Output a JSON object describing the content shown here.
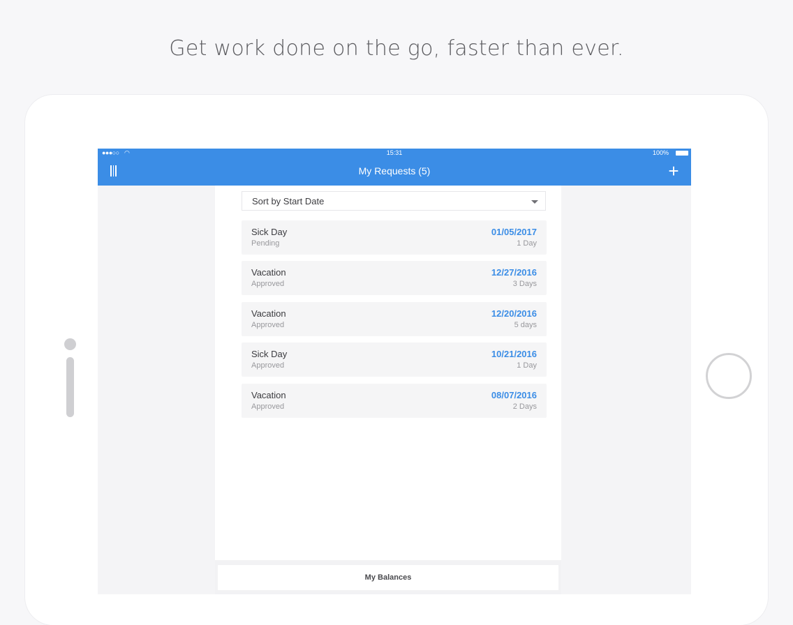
{
  "headline": "Get work done on the go, faster than ever.",
  "status_bar": {
    "signal": "●●●○○",
    "time": "15:31",
    "battery": "100%"
  },
  "nav": {
    "title": "My Requests (5)",
    "add_label": "+"
  },
  "sort": {
    "label": "Sort by Start Date"
  },
  "requests": [
    {
      "type": "Sick Day",
      "status": "Pending",
      "date": "01/05/2017",
      "duration": "1 Day"
    },
    {
      "type": "Vacation",
      "status": "Approved",
      "date": "12/27/2016",
      "duration": "3 Days"
    },
    {
      "type": "Vacation",
      "status": "Approved",
      "date": "12/20/2016",
      "duration": "5 days"
    },
    {
      "type": "Sick Day",
      "status": "Approved",
      "date": "10/21/2016",
      "duration": "1 Day"
    },
    {
      "type": "Vacation",
      "status": "Approved",
      "date": "08/07/2016",
      "duration": "2 Days"
    }
  ],
  "footer": {
    "balances_label": "My Balances"
  },
  "colors": {
    "accent": "#3b8de6",
    "background": "#f7f7f9"
  }
}
